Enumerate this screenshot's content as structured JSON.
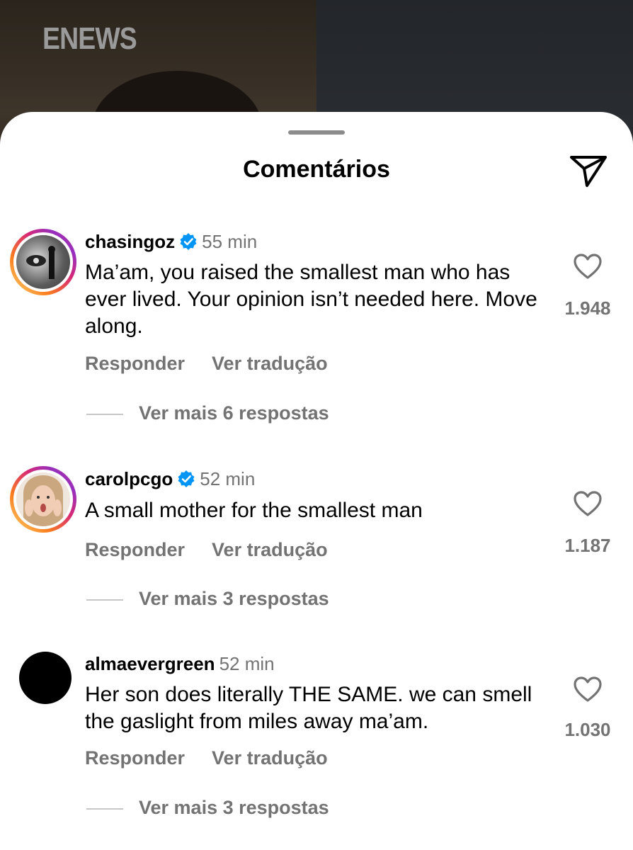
{
  "video": {
    "logo_text": "ENEWS"
  },
  "sheet": {
    "title": "Comentários"
  },
  "comments": [
    {
      "username": "chasingoz",
      "verified": true,
      "time": "55 min",
      "text": "Ma’am, you raised the smallest man who has ever lived. Your opinion isn’t needed here.  Move along.",
      "reply_label": "Responder",
      "translate_label": "Ver tradução",
      "likes": "1.948",
      "more_replies": "Ver mais 6 respostas"
    },
    {
      "username": "carolpcgo",
      "verified": true,
      "time": "52 min",
      "text": "A small mother for the smallest man",
      "reply_label": "Responder",
      "translate_label": "Ver tradução",
      "likes": "1.187",
      "more_replies": "Ver mais 3 respostas"
    },
    {
      "username": "almaevergreen",
      "verified": false,
      "time": "52 min",
      "text": "Her son does literally THE SAME. we can smell the gaslight from miles away ma’am.",
      "reply_label": "Responder",
      "translate_label": "Ver tradução",
      "likes": "1.030",
      "more_replies": "Ver mais 3 respostas"
    }
  ],
  "colors": {
    "secondary_text": "#737373",
    "verified_blue": "#0095f6",
    "story_ring": [
      "#feda75",
      "#fa7e1e",
      "#d62976",
      "#962fbf"
    ]
  },
  "icons": [
    "share-paper-plane-icon",
    "verified-badge-icon",
    "heart-outline-icon"
  ]
}
